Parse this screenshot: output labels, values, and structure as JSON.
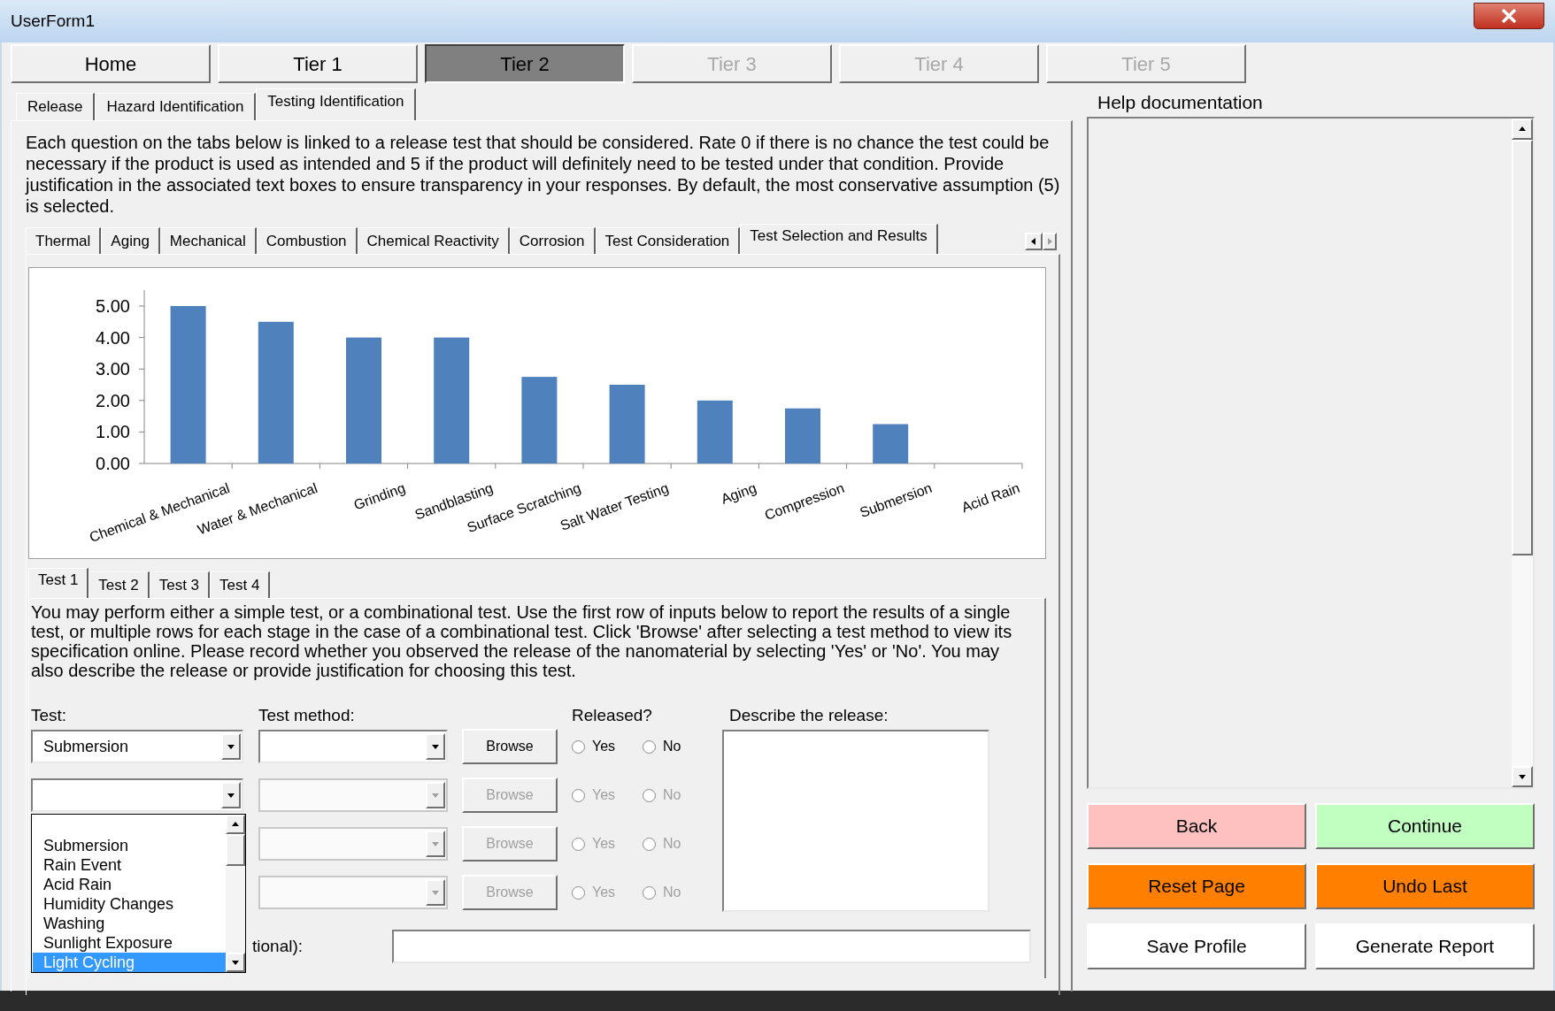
{
  "window": {
    "title": "UserForm1"
  },
  "tiers": [
    {
      "label": "Home",
      "selected": false,
      "disabled": false
    },
    {
      "label": "Tier 1",
      "selected": false,
      "disabled": false
    },
    {
      "label": "Tier 2",
      "selected": true,
      "disabled": false
    },
    {
      "label": "Tier 3",
      "selected": false,
      "disabled": true
    },
    {
      "label": "Tier 4",
      "selected": false,
      "disabled": true
    },
    {
      "label": "Tier 5",
      "selected": false,
      "disabled": true
    }
  ],
  "section_tabs": [
    {
      "label": "Release",
      "selected": false
    },
    {
      "label": "Hazard Identification",
      "selected": false
    },
    {
      "label": "Testing Identification",
      "selected": true
    }
  ],
  "intro": "Each question on the tabs below is linked to a release test that should be considered. Rate 0 if there is no chance the test could be necessary if the product is used as intended and 5 if the product will definitely need to be tested under that condition. Provide justification in the associated text boxes to ensure transparency in your responses. By default, the most conservative assumption (5) is selected.",
  "category_tabs": [
    {
      "label": "Thermal",
      "selected": false
    },
    {
      "label": "Aging",
      "selected": false
    },
    {
      "label": "Mechanical",
      "selected": false
    },
    {
      "label": "Combustion",
      "selected": false
    },
    {
      "label": "Chemical Reactivity",
      "selected": false
    },
    {
      "label": "Corrosion",
      "selected": false
    },
    {
      "label": "Test Consideration",
      "selected": false
    },
    {
      "label": "Test Selection and Results",
      "selected": true
    }
  ],
  "chart": {
    "chart_data": {
      "type": "bar",
      "categories": [
        "Chemical & Mechanical",
        "Water & Mechanical",
        "Grinding",
        "Sandblasting",
        "Surface Scratching",
        "Salt Water Testing",
        "Aging",
        "Compression",
        "Submersion",
        "Acid Rain"
      ],
      "series": [
        {
          "color": "#4f81bd",
          "values": [
            5,
            4.5,
            4,
            4,
            2.75,
            2.5,
            2,
            1.75,
            1.25,
            0
          ]
        }
      ],
      "ylim": [
        0,
        5
      ],
      "yticks": [
        {
          "value": 0,
          "label": "0.00"
        },
        {
          "value": 1,
          "label": "1.00"
        },
        {
          "value": 2,
          "label": "2.00"
        },
        {
          "value": 3,
          "label": "3.00"
        },
        {
          "value": 4,
          "label": "4.00"
        },
        {
          "value": 5,
          "label": "5.00"
        }
      ]
    }
  },
  "test_tabs": [
    {
      "label": "Test 1",
      "selected": true
    },
    {
      "label": "Test 2",
      "selected": false
    },
    {
      "label": "Test 3",
      "selected": false
    },
    {
      "label": "Test 4",
      "selected": false
    }
  ],
  "test_instructions": "You may perform either a simple test, or a combinational test. Use the first row of inputs below to report the results of a single test, or multiple rows for each stage in the case of a combinational test. Click 'Browse' after selecting a test method to view its specification online. Please record whether you observed the release of the nanomaterial by selecting 'Yes' or 'No'. You may also describe the release or provide justification for choosing this test.",
  "labels": {
    "test": "Test:",
    "method": "Test method:",
    "released": "Released?",
    "describe": "Describe the release:",
    "optional": "tional):"
  },
  "rows": [
    {
      "test": "Submersion",
      "disabled": false,
      "browse": "Browse",
      "yes": {
        "label": "Yes",
        "selected": false
      },
      "no": {
        "label": "No",
        "selected": false
      }
    },
    {
      "disabled": true,
      "browse": "Browse",
      "yes": {
        "label": "Yes",
        "selected": false
      },
      "no": {
        "label": "No",
        "selected": false
      }
    },
    {
      "disabled": true,
      "browse": "Browse",
      "yes": {
        "label": "Yes",
        "selected": false
      },
      "no": {
        "label": "No",
        "selected": false
      }
    },
    {
      "disabled": true,
      "browse": "Browse",
      "yes": {
        "label": "Yes",
        "selected": false
      },
      "no": {
        "label": "No",
        "selected": false
      }
    }
  ],
  "test_list": [
    {
      "label": "Submersion",
      "selected": false
    },
    {
      "label": "Rain Event",
      "selected": false
    },
    {
      "label": "Acid Rain",
      "selected": false
    },
    {
      "label": "Humidity Changes",
      "selected": false
    },
    {
      "label": "Washing",
      "selected": false
    },
    {
      "label": "Sunlight Exposure",
      "selected": false
    },
    {
      "label": "Light Cycling",
      "selected": true
    }
  ],
  "help": {
    "title": "Help documentation"
  },
  "buttons": [
    {
      "label": "Back",
      "color": "#ffc0c0"
    },
    {
      "label": "Continue",
      "color": "#c0ffc0"
    },
    {
      "label": "Reset Page",
      "color": "#ff8000"
    },
    {
      "label": "Undo Last",
      "color": "#ff8000"
    },
    {
      "label": "Save Profile",
      "color": "#ffffff"
    },
    {
      "label": "Generate Report",
      "color": "#ffffff"
    }
  ]
}
